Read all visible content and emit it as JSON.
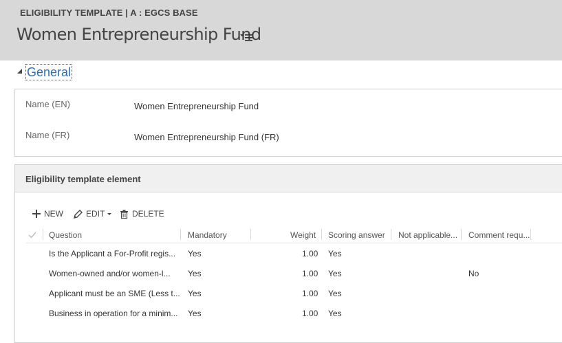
{
  "header": {
    "entity_type": "ELIGIBILITY TEMPLATE | A : EGCS BASE",
    "record_title": "Women Entrepreneurship Fund",
    "menu_icon": "list-menu-icon"
  },
  "general": {
    "title": "General",
    "fields": [
      {
        "label": "Name (EN)",
        "value": "Women Entrepreneurship Fund"
      },
      {
        "label": "Name (FR)",
        "value": "Women Entrepreneurship Fund (FR)"
      }
    ]
  },
  "subgrid": {
    "title": "Eligibility template element",
    "commands": {
      "new": "NEW",
      "edit": "EDIT",
      "delete": "DELETE"
    },
    "columns": [
      "Question",
      "Mandatory",
      "Weight",
      "Scoring answer",
      "Not applicable...",
      "Comment requ..."
    ],
    "rows": [
      {
        "question": "Is the Applicant a For-Profit regis...",
        "mandatory": "Yes",
        "weight": "1.00",
        "scoring": "Yes",
        "not_applicable": "",
        "comment": ""
      },
      {
        "question": "Women-owned and/or women-l...",
        "mandatory": "Yes",
        "weight": "1.00",
        "scoring": "Yes",
        "not_applicable": "",
        "comment": "No"
      },
      {
        "question": "Applicant must be an SME (Less t...",
        "mandatory": "Yes",
        "weight": "1.00",
        "scoring": "Yes",
        "not_applicable": "",
        "comment": ""
      },
      {
        "question": "Business in operation for a minim...",
        "mandatory": "Yes",
        "weight": "1.00",
        "scoring": "Yes",
        "not_applicable": "",
        "comment": ""
      }
    ]
  },
  "colors": {
    "header_bg": "#d8d8d8",
    "link_blue": "#2e6db4"
  }
}
